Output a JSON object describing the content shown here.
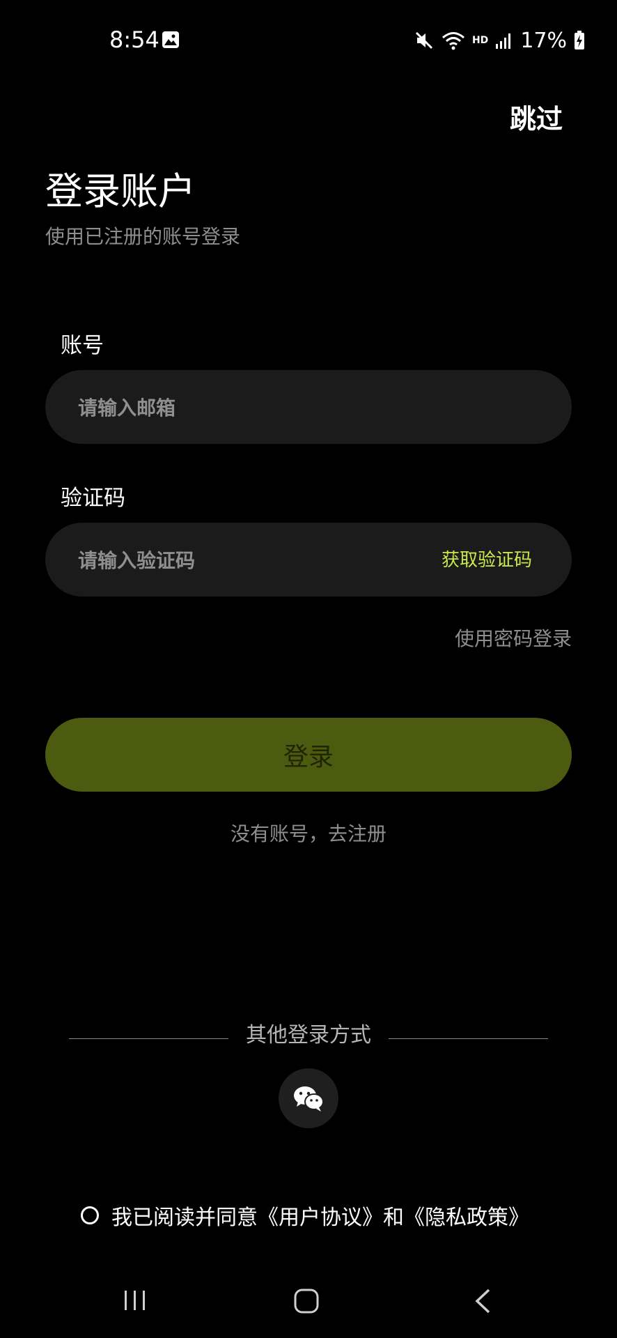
{
  "status_bar": {
    "time": "8:54",
    "network": "HD",
    "battery": "17%",
    "icons": [
      "gallery-icon",
      "mute-icon",
      "wifi-icon",
      "signal-icon",
      "battery-charging-icon"
    ]
  },
  "header": {
    "skip_label": "跳过",
    "title": "登录账户",
    "subtitle": "使用已注册的账号登录"
  },
  "form": {
    "account_label": "账号",
    "email_placeholder": "请输入邮箱",
    "email_value": "",
    "code_label": "验证码",
    "code_placeholder": "请输入验证码",
    "code_value": "",
    "get_code_label": "获取验证码",
    "password_login_label": "使用密码登录",
    "login_button_label": "登录",
    "register_label": "没有账号，去注册"
  },
  "other_login": {
    "title": "其他登录方式",
    "options": [
      "wechat-icon"
    ]
  },
  "agreement": {
    "checked": false,
    "text": "我已阅读并同意《用户协议》和《隐私政策》"
  },
  "colors": {
    "background": "#000000",
    "input_background": "#1b1b1b",
    "accent": "#c9e84a",
    "login_button": "#4c5b10",
    "muted_text": "#8e8e8e"
  }
}
